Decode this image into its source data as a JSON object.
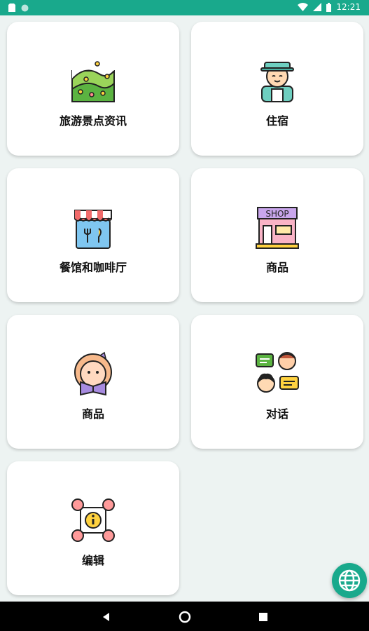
{
  "status_bar": {
    "time": "12:21",
    "left_icons": [
      "sim-card-icon",
      "circle-notification-icon"
    ],
    "right_icons": [
      "wifi-icon",
      "signal-icon",
      "battery-icon"
    ],
    "color": "#19a98c"
  },
  "cards": [
    {
      "label": "旅游景点资讯",
      "icon": "landscape-icon"
    },
    {
      "label": "住宿",
      "icon": "traveler-icon"
    },
    {
      "label": "餐馆和咖啡厅",
      "icon": "restaurant-icon"
    },
    {
      "label": "商品",
      "icon": "shop-icon"
    },
    {
      "label": "商品",
      "icon": "reading-girl-icon"
    },
    {
      "label": "对话",
      "icon": "conversation-icon"
    },
    {
      "label": "编辑",
      "icon": "network-info-icon"
    }
  ],
  "fab": {
    "icon": "globe-icon",
    "color": "#19a98c"
  },
  "nav_bar": {
    "icons": [
      "back-icon",
      "home-icon",
      "recent-apps-icon"
    ]
  }
}
